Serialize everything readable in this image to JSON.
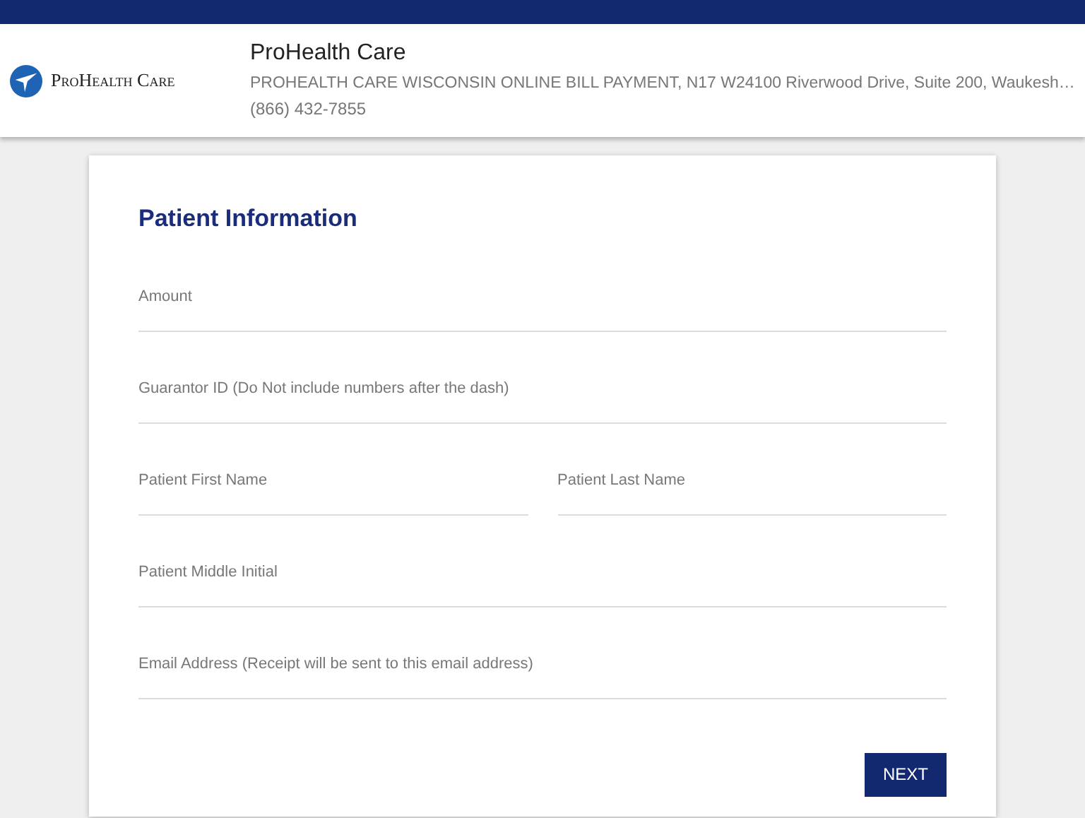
{
  "header": {
    "logo_text": "ProHealth Care",
    "title": "ProHealth Care",
    "address": "PROHEALTH CARE WISCONSIN ONLINE BILL PAYMENT, N17 W24100 Riverwood Drive, Suite 200, Waukesh…",
    "phone": "(866) 432-7855"
  },
  "form": {
    "title": "Patient Information",
    "rows": [
      [
        {
          "placeholder": "Amount"
        }
      ],
      [
        {
          "placeholder": "Guarantor ID (Do Not include numbers after the dash)"
        }
      ],
      [
        {
          "placeholder": "Patient First Name"
        },
        {
          "placeholder": "Patient Last Name"
        }
      ],
      [
        {
          "placeholder": "Patient Middle Initial"
        }
      ],
      [
        {
          "placeholder": "Email Address (Receipt will be sent to this email address)"
        }
      ]
    ],
    "button": "NEXT"
  }
}
